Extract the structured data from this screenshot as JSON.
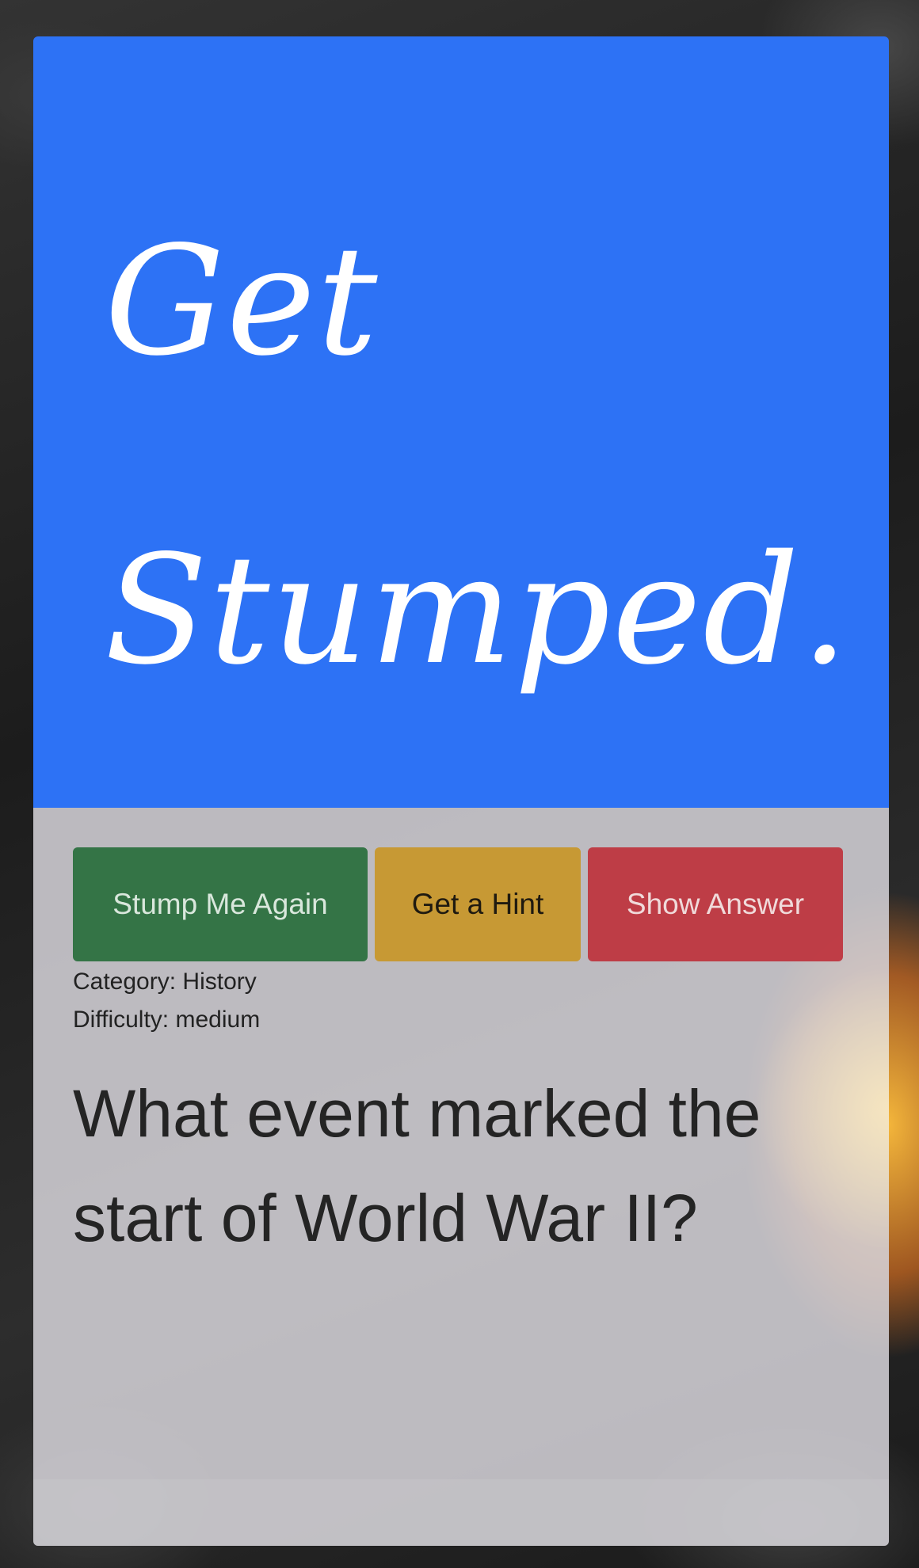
{
  "brand": {
    "logo_line_1": "Get",
    "logo_line_2": "Stumped."
  },
  "actions": {
    "stump_again_label": "Stump Me Again",
    "hint_label": "Get a Hint",
    "answer_label": "Show Answer"
  },
  "trivia": {
    "category_label": "Category:",
    "category": "History",
    "difficulty_label": "Difficulty:",
    "difficulty": "medium",
    "question": "What event marked the start of World War II?"
  },
  "colors": {
    "hero": "#2d72f5",
    "stump_again": "#286e3c",
    "hint": "#c89628",
    "answer": "#be323c"
  }
}
